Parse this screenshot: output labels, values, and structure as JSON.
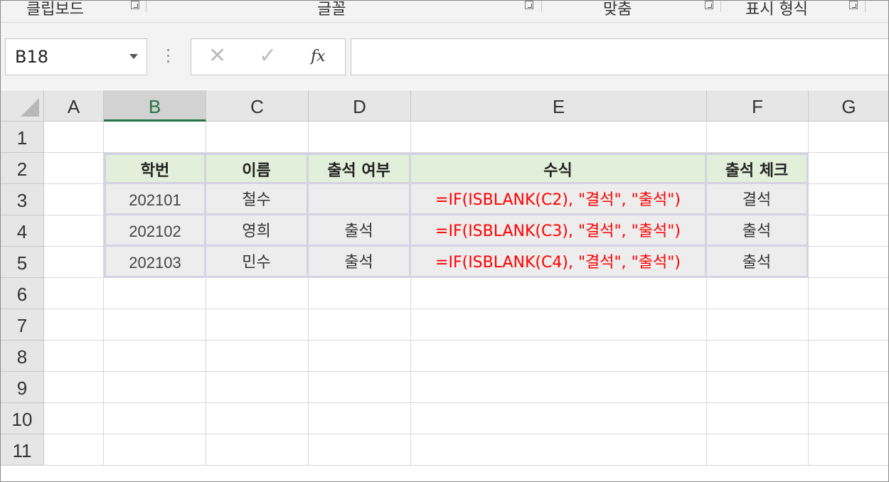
{
  "ribbon": {
    "groups": [
      {
        "label": "클립보드"
      },
      {
        "label": "글꼴"
      },
      {
        "label": "맞춤"
      },
      {
        "label": "표시 형식"
      }
    ]
  },
  "formula_bar": {
    "name_box": "B18",
    "cancel_glyph": "✕",
    "enter_glyph": "✓",
    "fx_label": "fx",
    "formula": ""
  },
  "sheet": {
    "columns": [
      "A",
      "B",
      "C",
      "D",
      "E",
      "F",
      "G"
    ],
    "selected_column": "B",
    "rows": [
      "1",
      "2",
      "3",
      "4",
      "5",
      "6",
      "7",
      "8",
      "9",
      "10",
      "11"
    ],
    "table": {
      "header": [
        "학번",
        "이름",
        "출석 여부",
        "수식",
        "출석 체크"
      ],
      "rows": [
        [
          "202101",
          "철수",
          "",
          "=IF(ISBLANK(C2), \"결석\", \"출석\")",
          "결석"
        ],
        [
          "202102",
          "영희",
          "출석",
          "=IF(ISBLANK(C3), \"결석\", \"출석\")",
          "출석"
        ],
        [
          "202103",
          "민수",
          "출석",
          "=IF(ISBLANK(C4), \"결석\", \"출석\")",
          "출석"
        ]
      ]
    },
    "colors": {
      "header_fill": "#e2efda",
      "body_fill": "#ededed",
      "formula_text": "#ff0000",
      "selected_header_accent": "#217346"
    }
  }
}
